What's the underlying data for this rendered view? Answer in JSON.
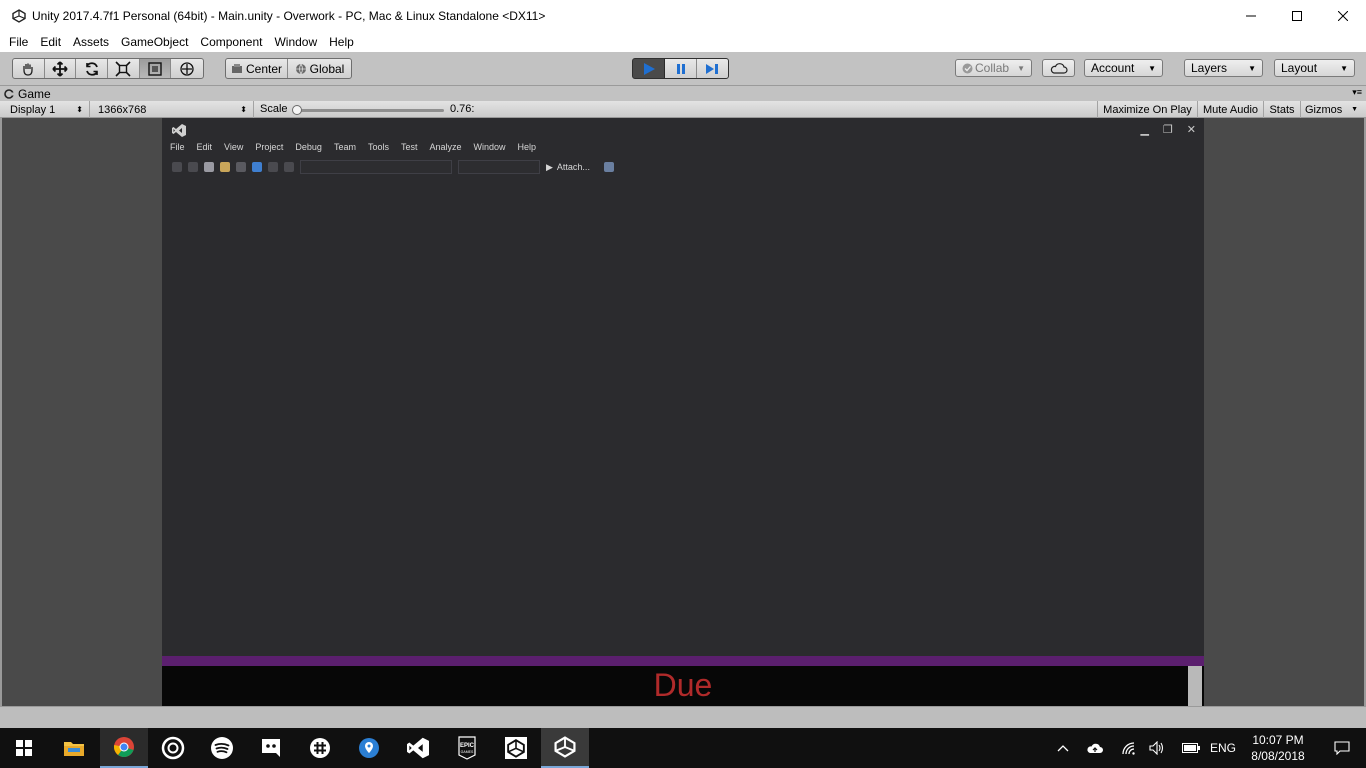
{
  "window": {
    "title": "Unity 2017.4.7f1 Personal (64bit) - Main.unity - Overwork - PC, Mac & Linux Standalone <DX11>"
  },
  "menu": [
    "File",
    "Edit",
    "Assets",
    "GameObject",
    "Component",
    "Window",
    "Help"
  ],
  "toolbar": {
    "tools": [
      "hand-tool",
      "move-tool",
      "rotate-tool",
      "scale-tool",
      "rect-tool",
      "transform-tool"
    ],
    "pivot_mode": "Center",
    "pivot_rotation": "Global",
    "collab": "Collab",
    "account": "Account",
    "layers": "Layers",
    "layout": "Layout"
  },
  "game_view": {
    "tab_label": "Game",
    "display": "Display 1",
    "resolution": "1366x768",
    "scale_label": "Scale",
    "scale_value": "0.76:",
    "maximize_on_play": "Maximize On Play",
    "mute_audio": "Mute Audio",
    "stats": "Stats",
    "gizmos": "Gizmos"
  },
  "vs_window": {
    "menu": [
      "File",
      "Edit",
      "View",
      "Project",
      "Debug",
      "Team",
      "Tools",
      "Test",
      "Analyze",
      "Window",
      "Help"
    ],
    "attach_label": "Attach..."
  },
  "game": {
    "due_text": "Due"
  },
  "taskbar": {
    "apps": [
      "file-explorer",
      "chrome",
      "osu",
      "spotify",
      "discord",
      "slack",
      "maps",
      "visual-studio",
      "epic-games",
      "unity-hub",
      "unity-editor"
    ],
    "language": "ENG",
    "time": "10:07 PM",
    "date": "8/08/2018"
  },
  "colors": {
    "unity_chrome": "#c2c2c2",
    "viewport_bg": "#2b2b2e",
    "purple_bar": "#5b1f6e",
    "due_red": "#b02a2a",
    "play_blue": "#1f6fd1",
    "taskbar": "#101010"
  }
}
